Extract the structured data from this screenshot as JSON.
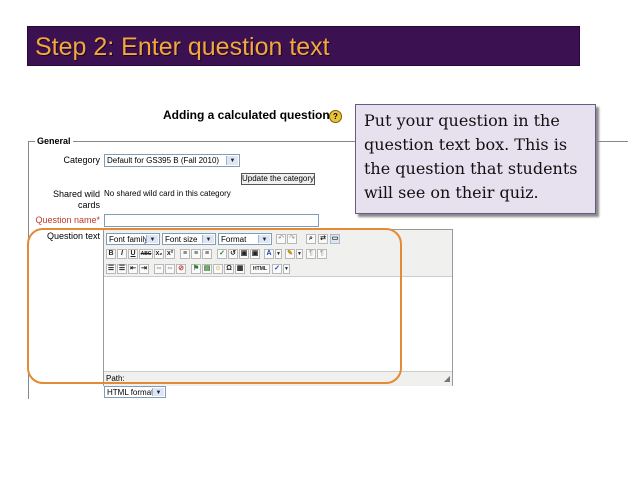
{
  "slide": {
    "title": "Step 2: Enter question text",
    "callout": "Put your question in the question text box. This is the question that students will see on their quiz."
  },
  "form": {
    "heading": "Adding a calculated question",
    "help_glyph": "?",
    "legend": "General",
    "category_label": "Category",
    "category_value": "Default for GS395 B (Fall 2010)",
    "update_category_button": "Update the category",
    "wildcards_label_1": "Shared wild",
    "wildcards_label_2": "cards",
    "wildcards_value": "No shared wild card in this category",
    "question_name_label": "Question name",
    "required_mark": "*",
    "question_text_label": "Question text"
  },
  "editor": {
    "font_family": "Font family",
    "font_size": "Font size",
    "format": "Format",
    "path_label": "Path:",
    "format_select": "HTML format",
    "row2_buttons": [
      "B",
      "I",
      "U",
      "ABC",
      "x₂",
      "x²",
      "≡",
      "≡",
      "≡",
      "✓",
      "↺",
      "▣",
      "▣",
      "A",
      "✎",
      "¶",
      "¶"
    ],
    "row3_buttons": [
      "☰",
      "☰",
      "⇤",
      "⇥",
      "∞",
      "∞",
      "⊘",
      "⚑",
      "▤",
      "☺",
      "Ω",
      "▦",
      "HTML",
      "✓"
    ]
  },
  "colors": {
    "banner_bg": "#3b1152",
    "banner_text": "#f3a73c",
    "callout_bg": "#e6e0ef",
    "highlight": "#e38a33",
    "required": "#c0392b"
  }
}
